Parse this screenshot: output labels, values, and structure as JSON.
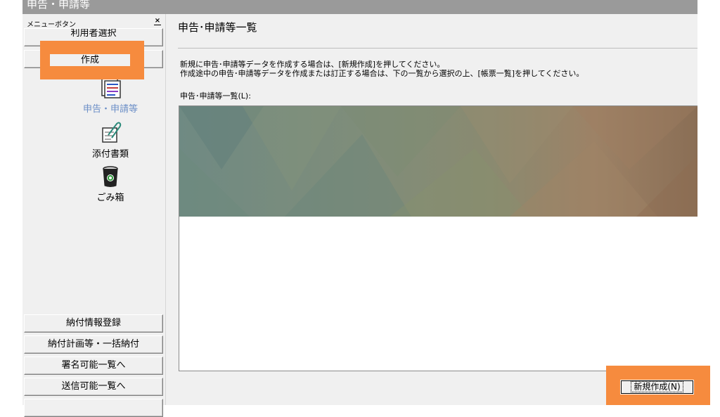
{
  "window": {
    "title": "申告・申請等"
  },
  "sidebar": {
    "header": "メニューボタン",
    "close_glyph": "×",
    "top_buttons": [
      {
        "label": "利用者選択"
      },
      {
        "label": "作成"
      }
    ],
    "items": [
      {
        "label": "申告・申請等",
        "icon": "forms-icon",
        "active": true
      },
      {
        "label": "添付書類",
        "icon": "attachment-icon",
        "active": false
      },
      {
        "label": "ごみ箱",
        "icon": "trash-bin-icon",
        "active": false
      }
    ],
    "bottom_buttons": [
      {
        "label": "納付情報登録"
      },
      {
        "label": "納付計画等・一括納付"
      },
      {
        "label": "署名可能一覧へ"
      },
      {
        "label": "送信可能一覧へ"
      }
    ]
  },
  "main": {
    "title": "申告･申請等一覧",
    "description_line1": "新規に申告･申請等データを作成する場合は、[新規作成]を押してください。",
    "description_line2": "作成途中の申告･申請等データを作成または訂正する場合は、下の一覧から選択の上、[帳票一覧]を押してください。",
    "list_label": "申告･申請等一覧(L):",
    "new_button_label": "新規作成(N)"
  },
  "colors": {
    "highlight": "#f68b3e",
    "titlebar": "#9a9a9a",
    "active_item": "#6c8fc7",
    "panel": "#f0f0f0"
  }
}
